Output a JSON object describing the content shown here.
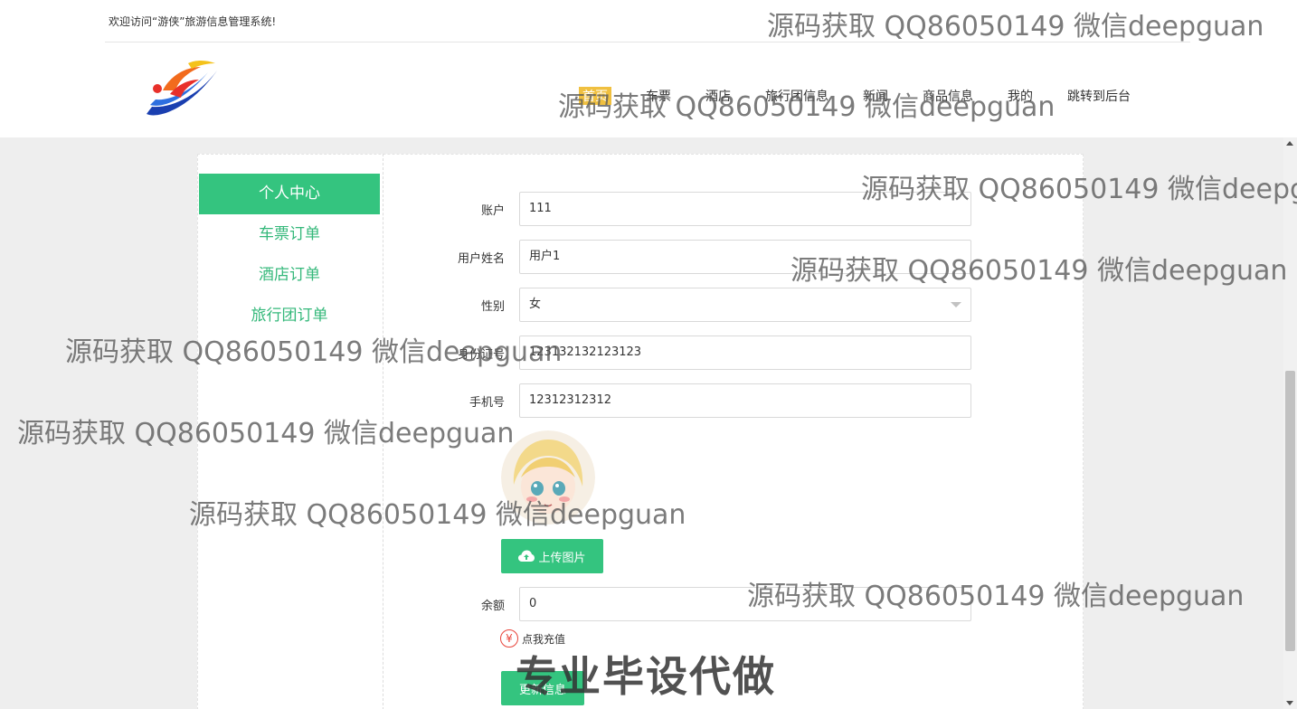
{
  "header": {
    "welcome": "欢迎访问“游侠”旅游信息管理系统!",
    "nav": [
      "首页",
      "车票",
      "酒店",
      "旅行团信息",
      "新闻",
      "商品信息",
      "我的",
      "跳转到后台"
    ]
  },
  "sidebar": {
    "items": [
      {
        "label": "个人中心",
        "active": true
      },
      {
        "label": "车票订单",
        "active": false
      },
      {
        "label": "酒店订单",
        "active": false
      },
      {
        "label": "旅行团订单",
        "active": false
      }
    ]
  },
  "form": {
    "account_label": "账户",
    "account_value": "111",
    "name_label": "用户姓名",
    "name_value": "用户1",
    "gender_label": "性别",
    "gender_value": "女",
    "idcard_label": "身份证号",
    "idcard_value": "123132132123123",
    "phone_label": "手机号",
    "phone_value": "12312312312",
    "upload_label": "上传图片",
    "balance_label": "余额",
    "balance_value": "0",
    "recharge_label": "点我充值",
    "update_label": "更新信息"
  },
  "watermarks": {
    "text": "源码获取 QQ86050149 微信deepguan",
    "text_cut": "源码获取 QQ86050149 微信deepg",
    "big": "专业毕设代做"
  },
  "colors": {
    "accent": "#34c47f",
    "accent_text": "#34b87a",
    "recharge_icon": "#e8443a"
  }
}
